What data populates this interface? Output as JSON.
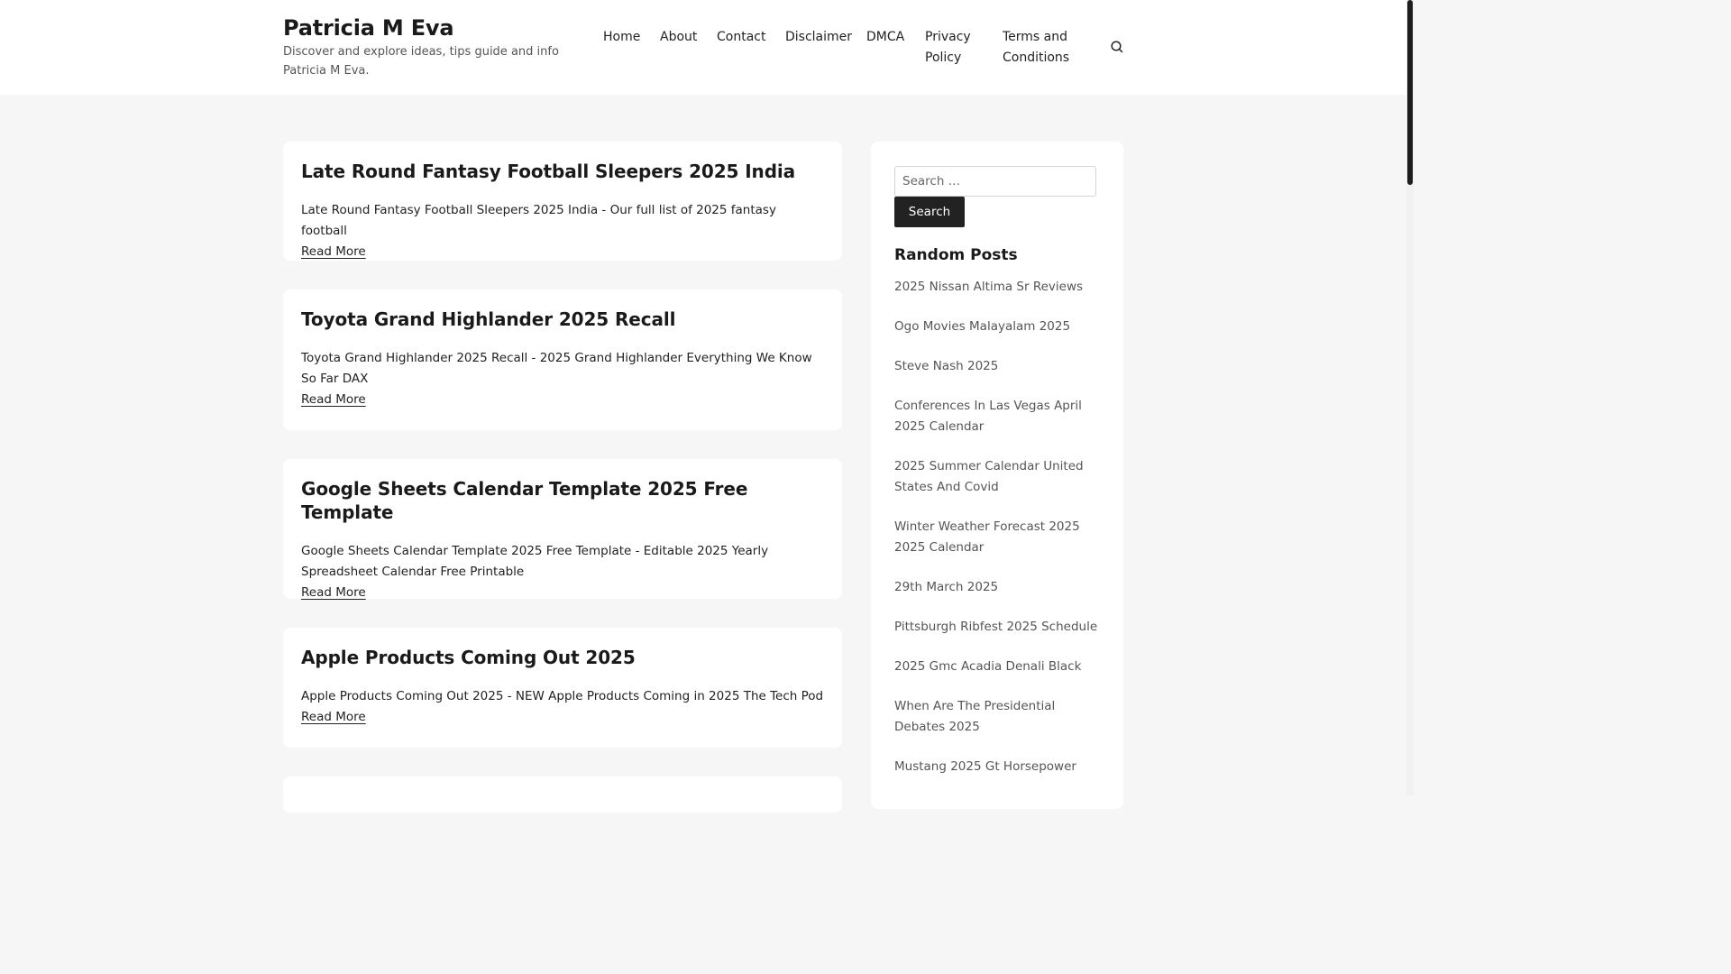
{
  "header": {
    "site_title": "Patricia M Eva",
    "site_description": "Discover and explore ideas, tips guide and info Patricia M Eva.",
    "nav": [
      "Home",
      "About",
      "Contact",
      "Disclaimer",
      "DMCA",
      "Privacy Policy",
      "Terms and Conditions"
    ],
    "search_icon": "search-icon"
  },
  "posts": [
    {
      "title": "Late Round Fantasy Football Sleepers 2025 India",
      "excerpt": "Late Round Fantasy Football Sleepers 2025 India - Our full list of 2025 fantasy football",
      "read_more": "Read More"
    },
    {
      "title": "Toyota Grand Highlander 2025 Recall",
      "excerpt": "Toyota Grand Highlander 2025 Recall - 2025 Grand Highlander Everything We Know So Far DAX",
      "read_more": "Read More"
    },
    {
      "title": "Google Sheets Calendar Template 2025 Free Template",
      "excerpt": "Google Sheets Calendar Template 2025 Free Template - Editable 2025 Yearly Spreadsheet Calendar Free Printable",
      "read_more": "Read More"
    },
    {
      "title": "Apple Products Coming Out 2025",
      "excerpt": "Apple Products Coming Out 2025 - NEW Apple Products Coming in 2025 The Tech Pod",
      "read_more": "Read More"
    }
  ],
  "sidebar": {
    "search_placeholder": "Search …",
    "search_button": "Search",
    "random_posts_title": "Random Posts",
    "random_posts": [
      "2025 Nissan Altima Sr Reviews",
      "Ogo Movies Malayalam 2025",
      "Steve Nash 2025",
      "Conferences In Las Vegas April 2025 Calendar",
      "2025 Summer Calendar United States And Covid",
      "Winter Weather Forecast 2025 2025 Calendar",
      "29th March 2025",
      "Pittsburgh Ribfest 2025 Schedule",
      "2025 Gmc Acadia Denali Black",
      "When Are The Presidential Debates 2025",
      "Mustang 2025 Gt Horsepower"
    ]
  }
}
